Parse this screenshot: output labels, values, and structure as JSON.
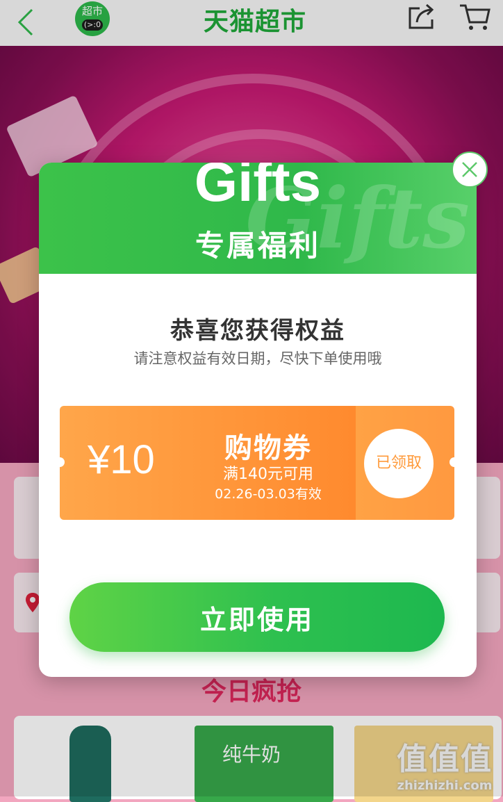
{
  "topbar": {
    "title": "天猫超市",
    "logo_text": "超市",
    "logo_sub": "(>:0"
  },
  "page": {
    "section_title": "今日疯抢",
    "product_milk_label": "纯牛奶",
    "watermark_main": "值值值",
    "watermark_url": "zhizhizhi.com"
  },
  "modal": {
    "header_title": "Gifts",
    "header_subtitle": "专属福利",
    "congrats": "恭喜您获得权益",
    "note": "请注意权益有效日期，尽快下单使用哦",
    "coupon": {
      "amount": "¥10",
      "type": "购物券",
      "condition": "满140元可用",
      "validity": "02.26-03.03有效",
      "status": "已领取"
    },
    "use_button": "立即使用"
  },
  "colors": {
    "brand_green": "#2fb84a",
    "coupon_orange": "#ff8a2e",
    "banner_pink": "#c71a73"
  },
  "icons": [
    "back-icon",
    "share-icon",
    "cart-icon",
    "close-icon",
    "location-pin-icon"
  ]
}
